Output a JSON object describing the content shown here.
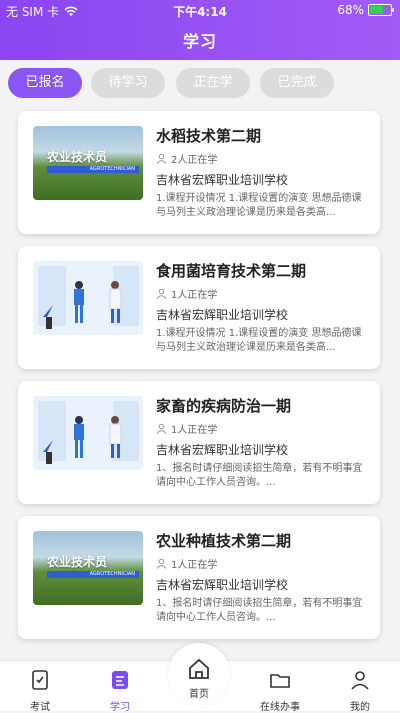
{
  "status_bar": {
    "carrier": "无 SIM 卡",
    "time": "下午4:14",
    "battery": "68%",
    "battery_level": 0.68
  },
  "header": {
    "title": "学习"
  },
  "tabs": [
    {
      "label": "已报名",
      "active": true
    },
    {
      "label": "待学习",
      "active": false
    },
    {
      "label": "正在学",
      "active": false
    },
    {
      "label": "已完成",
      "active": false
    }
  ],
  "courses": [
    {
      "title": "水稻技术第二期",
      "enrolled": "2人正在学",
      "school": "吉林省宏辉职业培训学校",
      "desc": "1.课程开设情况 1.课程设置的演变 思想品德课与马列主义政治理论课是历来是各类高...",
      "thumb": "agro",
      "thumb_label": "农业技术员",
      "thumb_sub": "AGROTECHNICIAN"
    },
    {
      "title": "食用菌培育技术第二期",
      "enrolled": "1人正在学",
      "school": "吉林省宏辉职业培训学校",
      "desc": "1.课程开设情况 1.课程设置的演变 思想品德课与马列主义政治理论课是历来是各类高...",
      "thumb": "lab"
    },
    {
      "title": "家畜的疾病防治一期",
      "enrolled": "1人正在学",
      "school": "吉林省宏辉职业培训学校",
      "desc": "1、报名时请仔细阅读招生简章，若有不明事宜请向中心工作人员咨询。...",
      "thumb": "lab"
    },
    {
      "title": "农业种植技术第二期",
      "enrolled": "1人正在学",
      "school": "吉林省宏辉职业培训学校",
      "desc": "1、报名时请仔细阅读招生简章，若有不明事宜请向中心工作人员咨询。...",
      "thumb": "agro",
      "thumb_label": "农业技术员",
      "thumb_sub": "AGROTECHNICIAN"
    }
  ],
  "tabbar": {
    "exam": "考试",
    "study": "学习",
    "home": "首页",
    "online": "在线办事",
    "mine": "我的"
  },
  "colors": {
    "accent": "#8a56f3",
    "tab_inactive": "#dcdcdc"
  }
}
